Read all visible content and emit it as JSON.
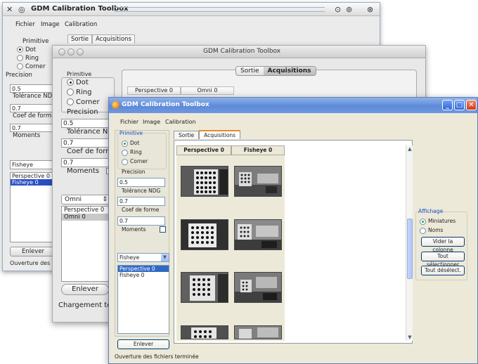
{
  "app": {
    "title": "GDM Calibration Toolbox"
  },
  "menu": {
    "fichier": "Fichier",
    "image": "Image",
    "calibration": "Calibration"
  },
  "tabs": {
    "sortie": "Sortie",
    "acquisitions": "Acquisitions"
  },
  "primitive": {
    "label": "Primitive",
    "dot": "Dot",
    "ring": "Ring",
    "corner": "Corner"
  },
  "params": {
    "precision_label": "Precision",
    "precision_value": "0.5",
    "tolerance_label": "Tolérance NDG",
    "tolerance_value": "0.7",
    "coef_label": "Coef de forme",
    "coef_value": "0.7",
    "moments_label": "Moments"
  },
  "camera_list": {
    "w1_selected": "Fisheye",
    "w1_items": [
      "Perspective 0",
      "Fisheye 0"
    ],
    "w2_selected": "Omni",
    "w2_items": [
      "Perspective 0",
      "Omni 0"
    ],
    "w3_selected": "Fisheye",
    "w3_items": [
      "Perspective 0",
      "Fisheye 0"
    ]
  },
  "columns": {
    "w2_cols": [
      "Perspective 0",
      "Omni 0"
    ],
    "w3_cols": [
      "Perspective 0",
      "Fisheye 0"
    ]
  },
  "buttons": {
    "enlever": "Enlever",
    "vider": "Vider la colonne",
    "tout_select": "Tout sélectionner",
    "tout_deselect": "Tout désélect."
  },
  "affichage": {
    "label": "Affichage",
    "miniatures": "Miniatures",
    "noms": "Noms"
  },
  "status": {
    "w1": "Ouverture des fichi",
    "w2": "Chargement termi",
    "w3": "Ouverture des fichiers terminée"
  },
  "w1_params": {
    "precision_label": "Precision",
    "precision_value": "0.5",
    "tolerance_label": "Tolérance NDG",
    "coef_value": "0.7",
    "coef_label": "Coef de forme",
    "moments_value": "0.7",
    "moments_label": "Moments"
  },
  "colors": {
    "xp_title": "#5d8ad8",
    "selection": "#316ac5",
    "kde_sel": "#2a4fc3"
  }
}
